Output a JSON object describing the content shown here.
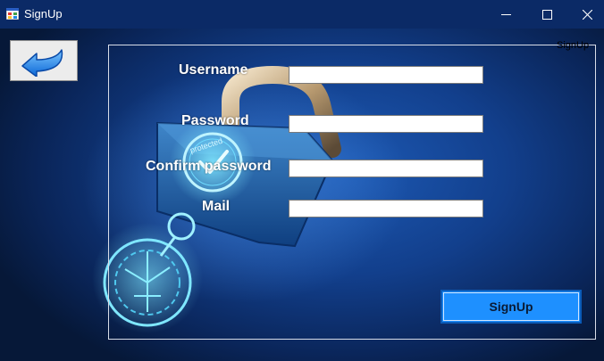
{
  "window": {
    "title": "SignUp",
    "app_icon": "winforms-app-icon",
    "controls": {
      "minimize_icon": "minimize-icon",
      "maximize_icon": "maximize-icon",
      "close_icon": "close-icon"
    }
  },
  "toolbar": {
    "back_icon": "back-arrow-icon"
  },
  "form": {
    "group_title": "SignUp",
    "username_label": "Username",
    "username_value": "",
    "password_label": "Password",
    "password_value": "",
    "confirm_label": "Confirm password",
    "confirm_value": "",
    "mail_label": "Mail",
    "mail_value": "",
    "submit_label": "SignUp"
  },
  "background": {
    "image": "padlock-protected-illustration",
    "lock_text": "protected",
    "colors": {
      "titlebar": "#0b2a66",
      "background_dark": "#061838",
      "background_mid": "#1d5ab5",
      "button": "#1e90ff"
    }
  }
}
